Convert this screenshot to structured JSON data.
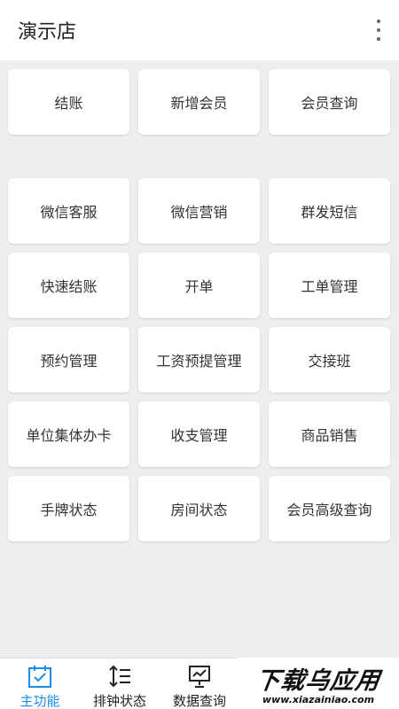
{
  "header": {
    "title": "演示店"
  },
  "top_tiles": [
    {
      "label": "结账"
    },
    {
      "label": "新增会员"
    },
    {
      "label": "会员查询"
    }
  ],
  "main_tiles": [
    {
      "label": "微信客服"
    },
    {
      "label": "微信营销"
    },
    {
      "label": "群发短信"
    },
    {
      "label": "快速结账"
    },
    {
      "label": "开单"
    },
    {
      "label": "工单管理"
    },
    {
      "label": "预约管理"
    },
    {
      "label": "工资预提管理"
    },
    {
      "label": "交接班"
    },
    {
      "label": "单位集体办卡"
    },
    {
      "label": "收支管理"
    },
    {
      "label": "商品销售"
    },
    {
      "label": "手牌状态"
    },
    {
      "label": "房间状态"
    },
    {
      "label": "会员高级查询"
    }
  ],
  "bottom_nav": [
    {
      "label": "主功能",
      "icon": "calendar-check-icon",
      "active": true
    },
    {
      "label": "排钟状态",
      "icon": "sort-list-icon",
      "active": false
    },
    {
      "label": "数据查询",
      "icon": "presentation-chart-icon",
      "active": false
    }
  ],
  "watermark": {
    "main": "下载乌应用",
    "url": "www.xiazainiao.com"
  },
  "colors": {
    "accent": "#1a8ceb",
    "background": "#eeeeee",
    "tile": "#ffffff"
  }
}
